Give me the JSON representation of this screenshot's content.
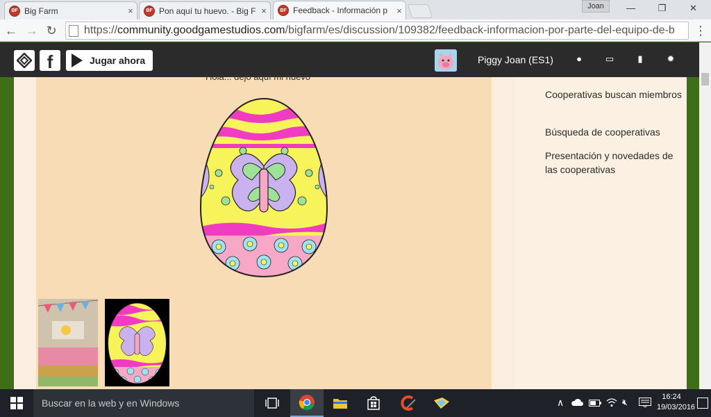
{
  "browser": {
    "tabs": [
      {
        "title": "Big Farm",
        "close": "×"
      },
      {
        "title": "Pon aquí tu huevo. - Big F",
        "close": "×"
      },
      {
        "title": "Feedback - Información p",
        "close": "×"
      }
    ],
    "favicon_text": "BF",
    "window_user": "Joan",
    "window_controls": {
      "minimize": "—",
      "maximize": "❐",
      "close": "✕"
    },
    "nav": {
      "back": "←",
      "forward": "→",
      "reload": "↻",
      "menu": "⋮"
    },
    "url": {
      "prefix": "https://",
      "host": "community.goodgamestudios.com",
      "path": "/bigfarm/es/discussion/109382/feedback-informacion-por-parte-del-equipo-de-b"
    }
  },
  "site_header": {
    "facebook_glyph": "f",
    "play_label": "Jugar ahora",
    "username": "Piggy Joan (ES1)",
    "icons": [
      "globe-icon",
      "inbox-icon",
      "bookmark-icon",
      "gear-icon"
    ],
    "icon_glyphs": {
      "globe": "●",
      "inbox": "▭",
      "bookmark": "▮",
      "gear": "✹"
    }
  },
  "post": {
    "cut_text": "Hola... dejo aquí mi huevo"
  },
  "sidebar": {
    "links": [
      "Cooperativas buscan miembros",
      "Búsqueda de cooperativas",
      "Presentación y novedades de las cooperativas"
    ]
  },
  "taskbar": {
    "search_placeholder": "Buscar en la web y en Windows",
    "tray_glyphs": {
      "chevron": "∧",
      "volume": "🔇︎"
    },
    "clock_time": "16:24",
    "clock_date": "19/03/2016"
  },
  "colors": {
    "egg_yellow": "#f7f35a",
    "egg_magenta": "#f03cc0",
    "egg_green": "#9ee29a",
    "egg_lilac": "#c9b2ee",
    "egg_pink": "#f7a8c6",
    "egg_cyan": "#9fe3f2"
  }
}
